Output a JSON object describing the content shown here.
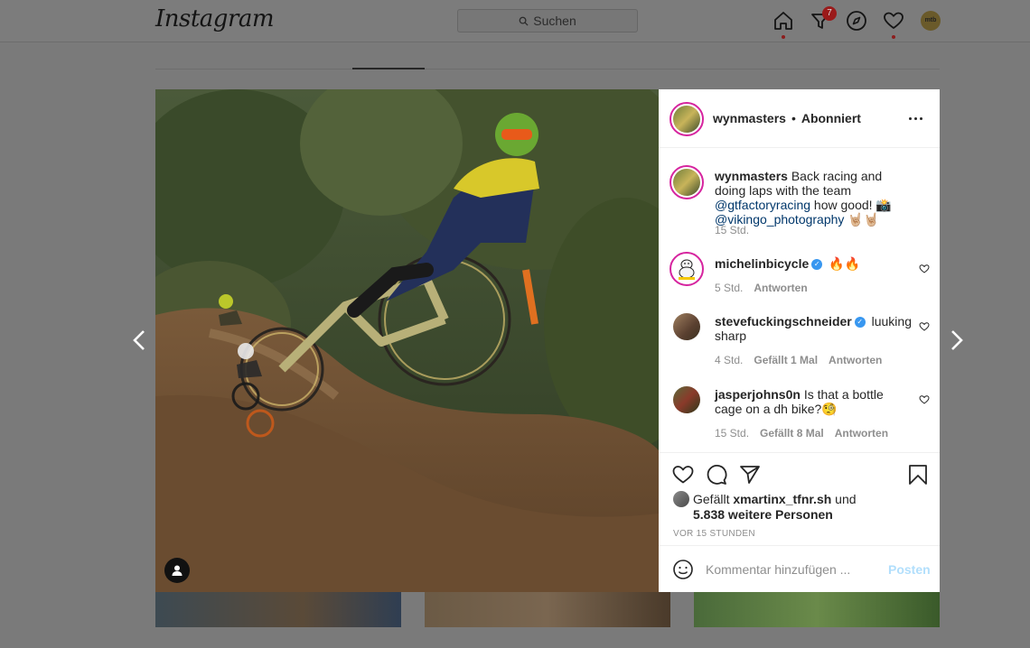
{
  "topbar": {
    "logo": "Instagram",
    "search_placeholder": "Suchen",
    "activity_badge": "7",
    "profile_mini_text": "mtb NEWS"
  },
  "arrows": {
    "prev": "previous-post",
    "next": "next-post"
  },
  "post": {
    "author": "wynmasters",
    "separator": "•",
    "follow_status": "Abonniert",
    "caption": {
      "author": "wynmasters",
      "text_1": "Back racing and doing laps with the team ",
      "mention_1": "@gtfactoryracing",
      "text_2": " how good! 📸 ",
      "mention_2": "@vikingo_photography",
      "text_3": " 🤘🏼🤘🏼",
      "time": "15 Std."
    },
    "comments": [
      {
        "user": "michelinbicycle",
        "verified": true,
        "text": "🔥🔥",
        "time": "5 Std.",
        "likes": "",
        "reply": "Antworten"
      },
      {
        "user": "stevefuckingschneider",
        "verified": true,
        "text": "luuking sharp",
        "time": "4 Std.",
        "likes": "Gefällt 1 Mal",
        "reply": "Antworten"
      },
      {
        "user": "jasperjohns0n",
        "verified": false,
        "text": "Is that a bottle cage on a dh bike?🧐",
        "time": "15 Std.",
        "likes": "Gefällt 8 Mal",
        "reply": "Antworten"
      }
    ],
    "likes": {
      "prefix": "Gefällt ",
      "user": "xmartinx_tfnr.sh",
      "mid": " und",
      "others": "5.838 weitere Personen"
    },
    "time_ago": "VOR 15 STUNDEN",
    "add_comment_placeholder": "Kommentar hinzufügen ...",
    "post_button": "Posten"
  },
  "colors": {
    "verified": "#3897f0",
    "ring": "#d6249f",
    "link": "#00376b",
    "post_disabled": "#b2dffc"
  }
}
